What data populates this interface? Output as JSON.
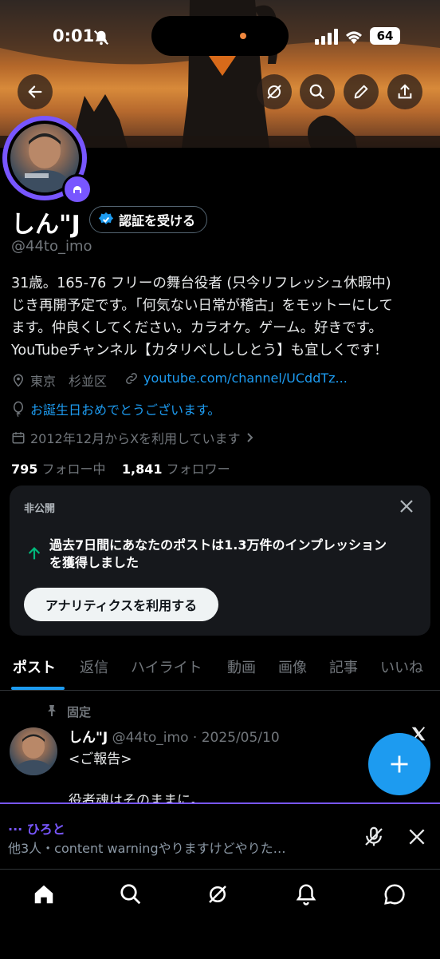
{
  "status_bar": {
    "time": "0:01",
    "battery": "64"
  },
  "profile": {
    "name": "しん\"J",
    "handle": "@44to_imo",
    "verify_label": "認証を受ける",
    "bio_lines": [
      "31歳。165-76 フリーの舞台役者 (只今リフレッシュ休暇中)",
      "じき再開予定です。「何気ない日常が稽古」をモットーにして",
      "ます。仲良くしてください。カラオケ。ゲーム。好きです。",
      "YouTubeチャンネル【カタリベしししとう】も宜しくです！"
    ],
    "location": "東京　杉並区",
    "url": "youtube.com/channel/UCddTz...",
    "birthday": "お誕生日おめでとうございます。",
    "joined": "2012年12月からXを利用しています",
    "following_count": "795",
    "following_label": "フォロー中",
    "followers_count": "1,841",
    "followers_label": "フォロワー"
  },
  "private_card": {
    "label": "非公開",
    "message_line1": "過去7日間にあなたのポストは1.3万件のインプレッション",
    "message_line2": "を獲得しました",
    "button": "アナリティクスを利用する"
  },
  "tabs": [
    "ポスト",
    "返信",
    "ハイライト",
    "動画",
    "画像",
    "記事",
    "いいね"
  ],
  "pinned_post": {
    "pinned_label": "固定",
    "author": "しん\"J",
    "meta": "@44to_imo · 2025/05/10",
    "line1": "<ご報告>",
    "line2": "役者魂はそのままに。"
  },
  "space_bar": {
    "title": "··· ひろと",
    "subtitle": "他3人・content warningやりますけどやりた…"
  },
  "colors": {
    "accent": "#1d9bf0",
    "spaces": "#7856ff",
    "positive": "#00ba7c"
  }
}
